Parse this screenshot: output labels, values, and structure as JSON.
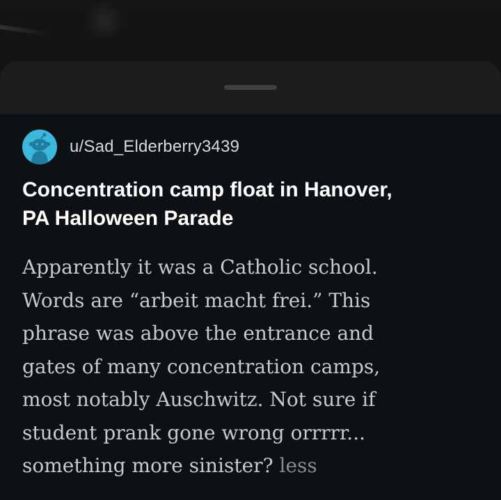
{
  "post": {
    "author": "u/Sad_Elderberry3439",
    "title_lines": [
      "Concentration camp float in Hanover,",
      "PA Halloween Parade"
    ],
    "body_lines": [
      "Apparently it was a Catholic school.",
      "Words are “arbeit macht frei.” This",
      "phrase was above the entrance and",
      "gates of many concentration camps,",
      "most notably Auschwitz. Not sure if",
      "student prank gone wrong orrrrr..."
    ],
    "body_last_line": "something more sinister?",
    "less_label": "less"
  },
  "colors": {
    "avatar_bg": "#3bb8dc",
    "sheet_bg": "#1b1c1e",
    "content_bg": "#0d1114",
    "title_color": "#ffffff",
    "body_color": "#c8cbcd",
    "link_color": "#8a8d90"
  },
  "icons": {
    "avatar": "snoo-avatar-icon"
  }
}
